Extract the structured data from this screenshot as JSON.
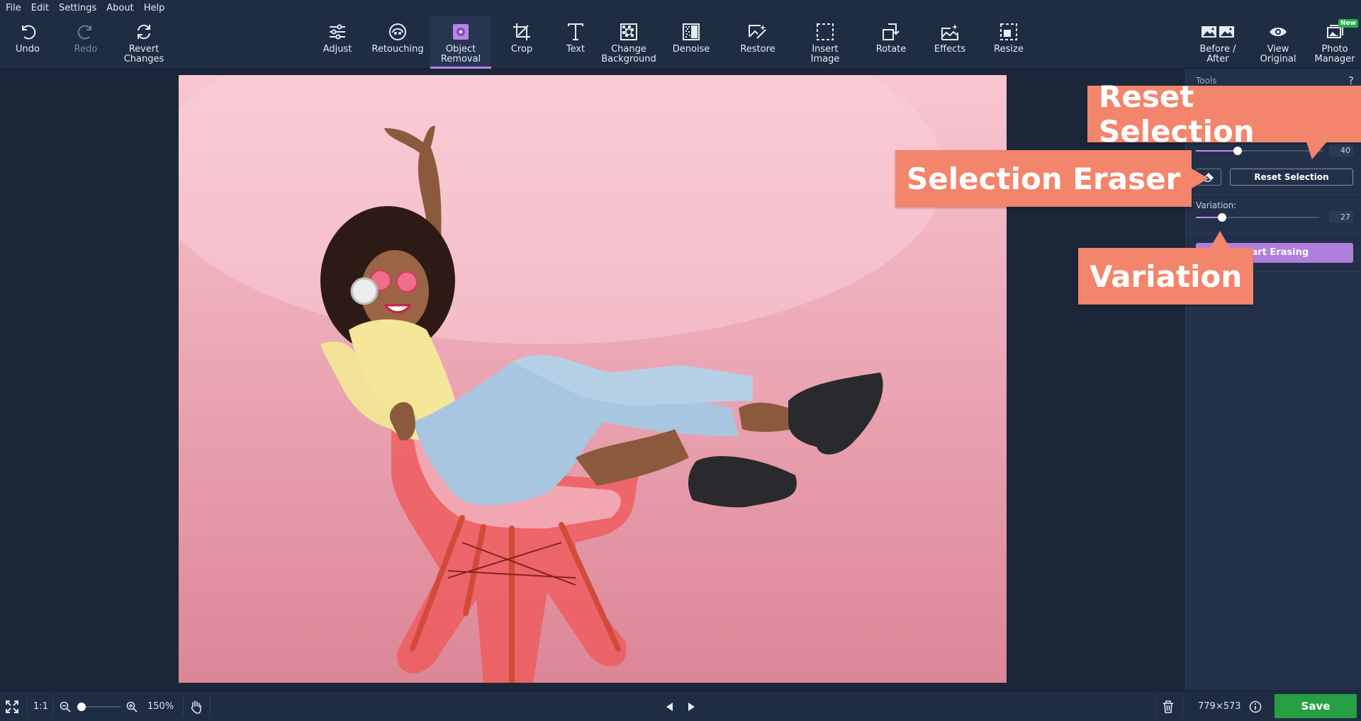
{
  "menu": [
    "File",
    "Edit",
    "Settings",
    "About",
    "Help"
  ],
  "toolbar": {
    "undo": "Undo",
    "redo": "Redo",
    "revert": "Revert\nChanges",
    "adjust": "Adjust",
    "retouching": "Retouching",
    "object_removal": "Object\nRemoval",
    "crop": "Crop",
    "text": "Text",
    "change_background": "Change\nBackground",
    "denoise": "Denoise",
    "restore": "Restore",
    "insert_image": "Insert\nImage",
    "rotate": "Rotate",
    "effects": "Effects",
    "resize": "Resize",
    "before_after": "Before /\nAfter",
    "view_original": "View\nOriginal",
    "photo_manager": "Photo\nManager",
    "new_badge": "New"
  },
  "panel": {
    "title": "Tools",
    "help": "?",
    "brush_size_value": "40",
    "brush_size_fraction": 0.33,
    "reset_selection": "Reset Selection",
    "variation_label": "Variation:",
    "variation_value": "27",
    "variation_fraction": 0.21,
    "start_erasing": "Start Erasing"
  },
  "callouts": {
    "reset_selection": "Reset Selection",
    "selection_eraser": "Selection Eraser",
    "variation": "Variation"
  },
  "status": {
    "fit": "1:1",
    "zoom": "150%",
    "zoom_fraction": 0.12,
    "dimensions": "779×573",
    "save": "Save"
  },
  "colors": {
    "accent": "#b985e6",
    "callout": "#f2856b",
    "save": "#26a043",
    "selection_mask": "#ef5a5a"
  }
}
